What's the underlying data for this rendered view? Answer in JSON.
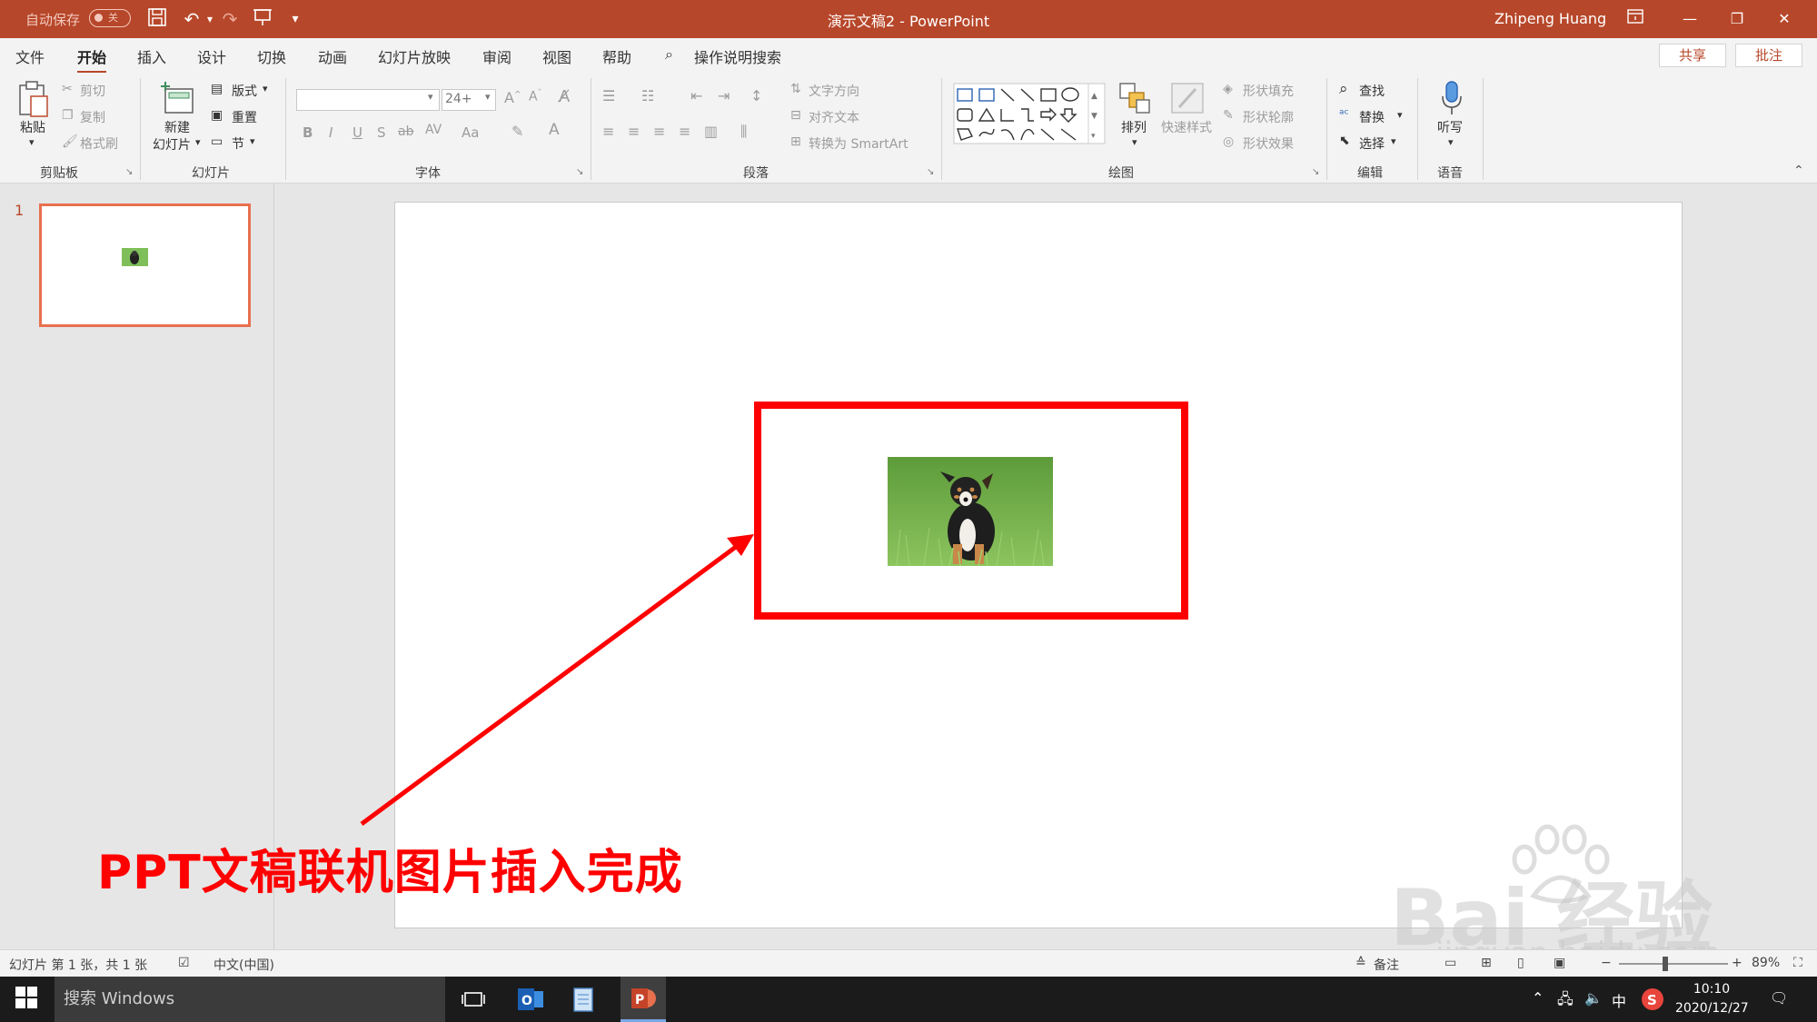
{
  "titlebar": {
    "autosave_label": "自动保存",
    "autosave_state": "关",
    "doc_title": "演示文稿2  -  PowerPoint",
    "user_name": "Zhipeng Huang"
  },
  "tabs": [
    "文件",
    "开始",
    "插入",
    "设计",
    "切换",
    "动画",
    "幻灯片放映",
    "审阅",
    "视图",
    "帮助"
  ],
  "active_tab": "开始",
  "tell_me": "操作说明搜索",
  "share_label": "共享",
  "comment_label": "批注",
  "ribbon": {
    "clipboard": {
      "label": "剪贴板",
      "paste": "粘贴",
      "cut": "剪切",
      "copy": "复制",
      "format_painter": "格式刷"
    },
    "slides": {
      "label": "幻灯片",
      "new_slide": "新建\n幻灯片",
      "new_slide_l1": "新建",
      "new_slide_l2": "幻灯片",
      "layout": "版式",
      "reset": "重置",
      "section": "节"
    },
    "font": {
      "label": "字体",
      "size": "24+",
      "bold": "B",
      "italic": "I",
      "underline": "U",
      "shadow": "S",
      "strike": "ab",
      "spacing": "AV",
      "case": "Aa"
    },
    "paragraph": {
      "label": "段落",
      "text_direction": "文字方向",
      "align_text": "对齐文本",
      "smartart": "转换为 SmartArt"
    },
    "drawing": {
      "label": "绘图",
      "arrange": "排列",
      "quick_styles": "快速样式",
      "shape_fill": "形状填充",
      "shape_outline": "形状轮廓",
      "shape_effects": "形状效果"
    },
    "editing": {
      "label": "编辑",
      "find": "查找",
      "replace": "替换",
      "select": "选择"
    },
    "voice": {
      "label": "语音",
      "dictate": "听写"
    }
  },
  "thumbnails": {
    "slide_number": "1"
  },
  "annotation": {
    "text": "PPT文稿联机图片插入完成"
  },
  "watermark": {
    "brand": "Bai  经验",
    "url": "jingyan.baidu.com"
  },
  "status": {
    "slide_info": "幻灯片 第 1 张，共 1 张",
    "language": "中文(中国)",
    "notes": "备注",
    "zoom": "89%"
  },
  "taskbar": {
    "search_placeholder": "搜索 Windows",
    "ime": "中",
    "time": "10:10",
    "date": "2020/12/27"
  },
  "colors": {
    "accent": "#b7472a",
    "highlight": "#ff0000",
    "thumb_border": "#e8704e"
  }
}
